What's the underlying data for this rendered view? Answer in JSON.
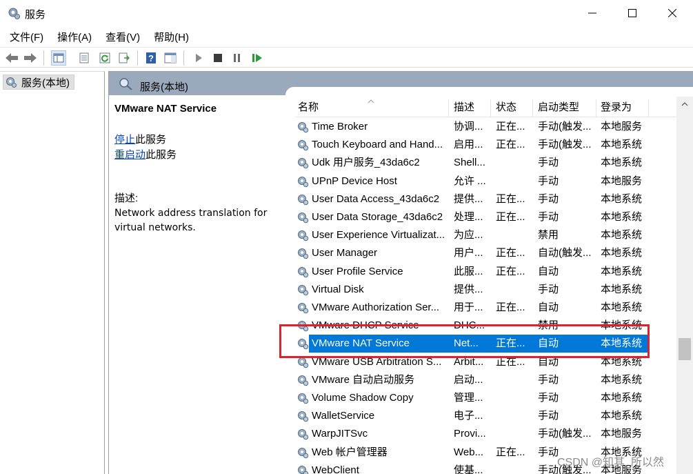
{
  "window": {
    "title": "服务"
  },
  "menu": [
    "文件(F)",
    "操作(A)",
    "查看(V)",
    "帮助(H)"
  ],
  "tree": {
    "root_label": "服务(本地)"
  },
  "panel": {
    "header_title": "服务(本地)",
    "selected_service": "VMware NAT Service",
    "stop_link": "停止",
    "stop_suffix": "此服务",
    "restart_link": "重启动",
    "restart_suffix": "此服务",
    "desc_label": "描述:",
    "desc_text_line1": "Network address translation for",
    "desc_text_line2": "virtual networks."
  },
  "columns": {
    "name": "名称",
    "desc": "描述",
    "status": "状态",
    "startup": "启动类型",
    "logon": "登录为"
  },
  "rows": [
    {
      "name": "Time Broker",
      "desc": "协调...",
      "status": "正在...",
      "startup": "手动(触发...",
      "logon": "本地服务"
    },
    {
      "name": "Touch Keyboard and Hand...",
      "desc": "启用...",
      "status": "正在...",
      "startup": "手动(触发...",
      "logon": "本地系统"
    },
    {
      "name": "Udk 用户服务_43da6c2",
      "desc": "Shell...",
      "status": "",
      "startup": "手动",
      "logon": "本地系统"
    },
    {
      "name": "UPnP Device Host",
      "desc": "允许 ...",
      "status": "",
      "startup": "手动",
      "logon": "本地服务"
    },
    {
      "name": "User Data Access_43da6c2",
      "desc": "提供...",
      "status": "正在...",
      "startup": "手动",
      "logon": "本地系统"
    },
    {
      "name": "User Data Storage_43da6c2",
      "desc": "处理...",
      "status": "正在...",
      "startup": "手动",
      "logon": "本地系统"
    },
    {
      "name": "User Experience Virtualizat...",
      "desc": "为应...",
      "status": "",
      "startup": "禁用",
      "logon": "本地系统"
    },
    {
      "name": "User Manager",
      "desc": "用户...",
      "status": "正在...",
      "startup": "自动(触发...",
      "logon": "本地系统"
    },
    {
      "name": "User Profile Service",
      "desc": "此服...",
      "status": "正在...",
      "startup": "自动",
      "logon": "本地系统"
    },
    {
      "name": "Virtual Disk",
      "desc": "提供...",
      "status": "",
      "startup": "手动",
      "logon": "本地系统"
    },
    {
      "name": "VMware Authorization Ser...",
      "desc": "用于...",
      "status": "正在...",
      "startup": "自动",
      "logon": "本地系统"
    },
    {
      "name": "VMware DHCP Service",
      "desc": "DHC...",
      "status": "",
      "startup": "禁用",
      "logon": "本地系统"
    },
    {
      "name": "VMware NAT Service",
      "desc": "Net...",
      "status": "正在...",
      "startup": "自动",
      "logon": "本地系统"
    },
    {
      "name": "VMware USB Arbitration S...",
      "desc": "Arbit...",
      "status": "正在...",
      "startup": "自动",
      "logon": "本地系统"
    },
    {
      "name": "VMware 自动启动服务",
      "desc": "启动...",
      "status": "",
      "startup": "手动",
      "logon": "本地系统"
    },
    {
      "name": "Volume Shadow Copy",
      "desc": "管理...",
      "status": "",
      "startup": "手动",
      "logon": "本地系统"
    },
    {
      "name": "WalletService",
      "desc": "电子...",
      "status": "",
      "startup": "手动",
      "logon": "本地系统"
    },
    {
      "name": "WarpJITSvc",
      "desc": "Provi...",
      "status": "",
      "startup": "手动(触发...",
      "logon": "本地服务"
    },
    {
      "name": "Web 帐户管理器",
      "desc": "Web...",
      "status": "正在...",
      "startup": "手动",
      "logon": "本地系统"
    },
    {
      "name": "WebClient",
      "desc": "使基...",
      "status": "",
      "startup": "手动(触发...",
      "logon": "本地服务"
    }
  ],
  "selected_row_index": 12,
  "colors": {
    "selection": "#0078d7",
    "header_band": "#9aa9bb",
    "annotation": "#d9232e",
    "link": "#0645ad"
  },
  "watermark": "CSDN @知其_所以然"
}
